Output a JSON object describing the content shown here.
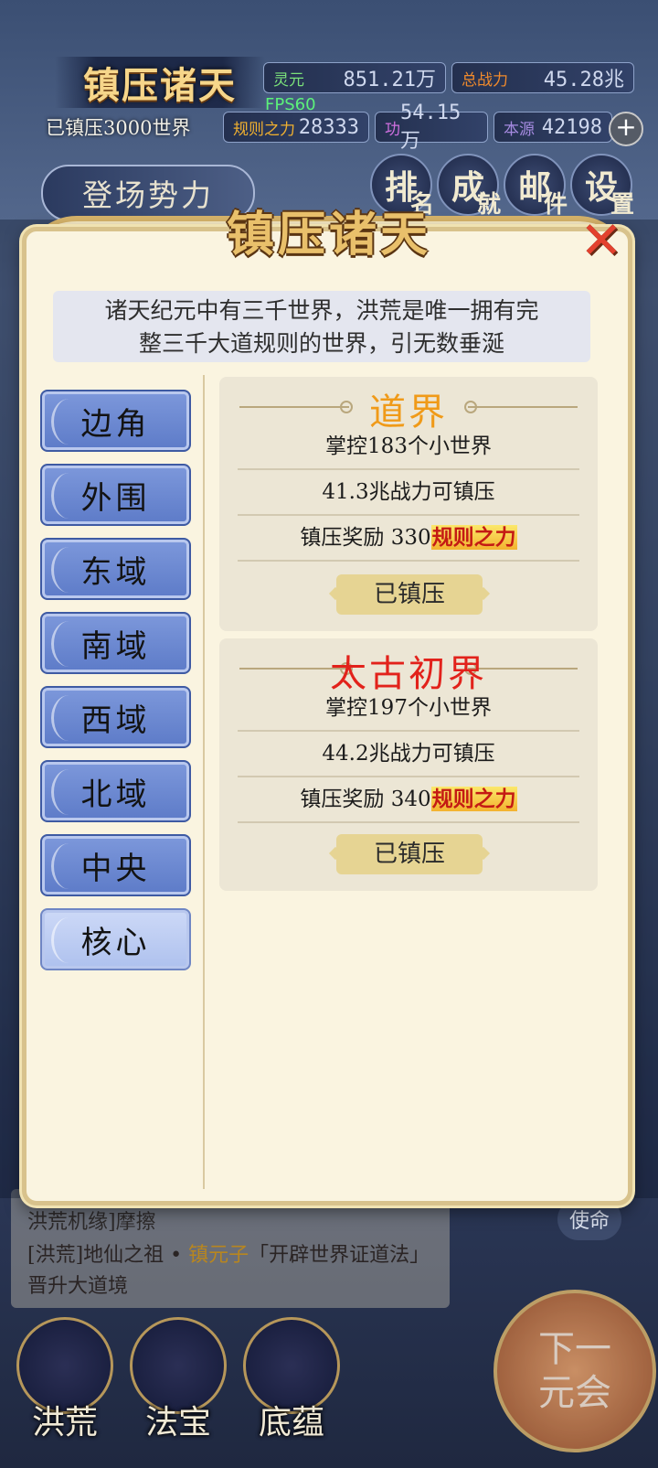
{
  "hud": {
    "title": "镇压诸天",
    "lingyuan_label": "灵元",
    "lingyuan_value": "851.21万",
    "zhanli_label": "总战力",
    "zhanli_value": "45.28兆",
    "subdued_text": "已镇压3000世界",
    "fps": "FPS60",
    "rule_label": "规则之力",
    "rule_value": "28333",
    "gong_label": "功",
    "gong_value": "54.15万",
    "source_label": "本源",
    "source_value": "42198",
    "plus": "+",
    "enter_btn": "登场势力",
    "icons": [
      {
        "main": "排",
        "small": "名"
      },
      {
        "main": "成",
        "small": "就"
      },
      {
        "main": "邮",
        "small": "件"
      },
      {
        "main": "设",
        "small": "置"
      }
    ]
  },
  "modal": {
    "title": "镇压诸天",
    "close": "✕",
    "desc_line1": "诸天纪元中有三千世界，洪荒是唯一拥有完",
    "desc_line2": "整三千大道规则的世界，引无数垂涎",
    "regions": [
      "边角",
      "外围",
      "东域",
      "南域",
      "西域",
      "北域",
      "中央",
      "核心"
    ],
    "active_region": "核心",
    "worlds": [
      {
        "name": "道界",
        "name_color": "#f09a18",
        "control": "掌控183个小世界",
        "power": "41.3兆战力可镇压",
        "reward_prefix": "镇压奖励 330",
        "reward_unit": "规则之力",
        "status": "已镇压"
      },
      {
        "name": "太古初界",
        "name_color": "#e2221b",
        "control": "掌控197个小世界",
        "power": "44.2兆战力可镇压",
        "reward_prefix": "镇压奖励 340",
        "reward_unit": "规则之力",
        "status": "已镇压"
      }
    ]
  },
  "log": {
    "line1": "洪荒机缘]摩擦",
    "line2_a": "[洪荒]地仙之祖 • ",
    "line2_hl": "镇元子",
    "line2_b": "「开辟世界证道法」晋升大道境"
  },
  "bottom_nav": [
    "洪荒",
    "法宝",
    "底蕴"
  ],
  "right_btn": "使命",
  "next_btn_line1": "下一",
  "next_btn_line2": "元会"
}
